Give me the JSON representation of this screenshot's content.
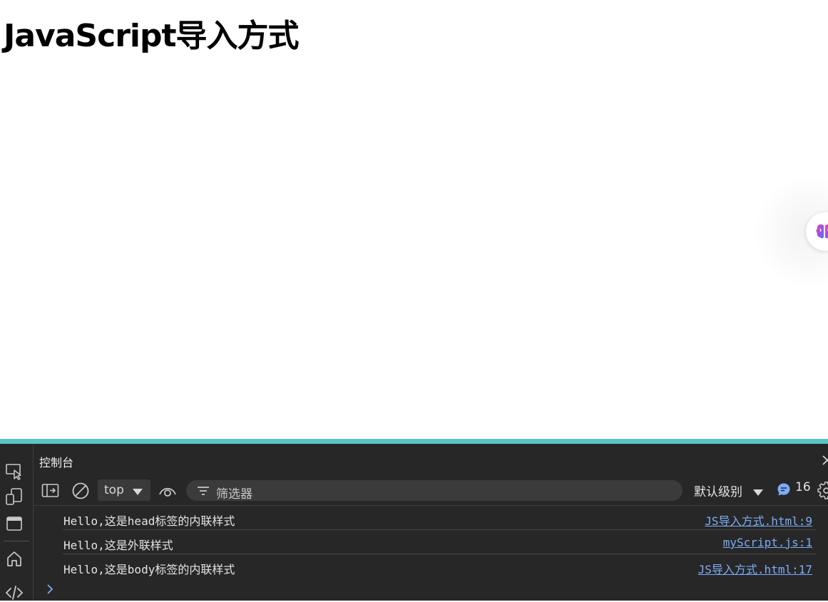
{
  "page": {
    "title": "JavaScript导入方式"
  },
  "floating_button": {
    "icon": "brain-icon"
  },
  "devtools": {
    "panel_title": "控制台",
    "context": "top",
    "filter_placeholder": "筛选器",
    "log_level": "默认级别",
    "message_count": "16",
    "logs": [
      {
        "message": "Hello,这是head标签的内联样式",
        "source": "JS导入方式.html:9"
      },
      {
        "message": "Hello,这是外联样式",
        "source": "myScript.js:1"
      },
      {
        "message": "Hello,这是body标签的内联样式",
        "source": "JS导入方式.html:17"
      }
    ],
    "colors": {
      "accent": "#5bc4c4",
      "link": "#7cacf8",
      "background": "#272727"
    }
  }
}
